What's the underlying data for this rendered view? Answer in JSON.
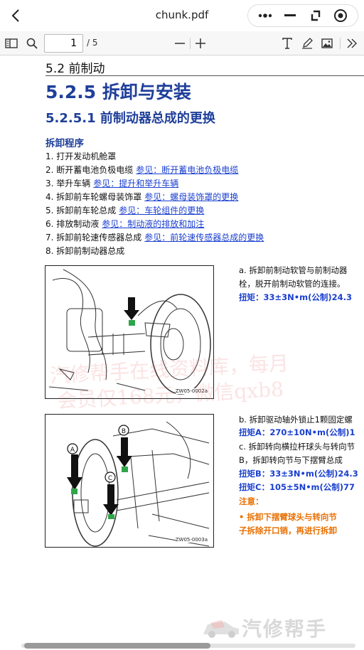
{
  "app": {
    "title": "chunk.pdf"
  },
  "toolbar": {
    "page_current": "1",
    "page_total": "/ 5"
  },
  "doc": {
    "section": "5.2 前制动",
    "heading1": "5.2.5 拆卸与安装",
    "heading2": "5.2.5.1 前制动器总成的更换",
    "heading3": "拆卸程序",
    "steps": [
      {
        "num": "1.",
        "text": "打开发动机舱罩",
        "link": ""
      },
      {
        "num": "2.",
        "text": "断开蓄电池负极电缆",
        "link": "参见：断开蓄电池负极电缆"
      },
      {
        "num": "3.",
        "text": "举升车辆",
        "link": "参见：提升和举升车辆"
      },
      {
        "num": "4.",
        "text": "拆卸前车轮螺母装饰罩",
        "link": "参见：螺母装饰罩的更换"
      },
      {
        "num": "5.",
        "text": "拆卸前车轮总成",
        "link": "参见：车轮组件的更换"
      },
      {
        "num": "6.",
        "text": "排放制动液",
        "link": "参见：制动液的排放和加注"
      },
      {
        "num": "7.",
        "text": "拆卸前轮速传感器总成",
        "link": "参见：前轮速传感器总成的更换"
      },
      {
        "num": "8.",
        "text": "拆卸前制动器总成",
        "link": ""
      }
    ],
    "figures": [
      {
        "code": "ZW05-0002a"
      },
      {
        "code": "ZW05-0003a",
        "labels": [
          "A",
          "B",
          "C"
        ]
      }
    ],
    "right_lines": [
      {
        "text": "a.  拆卸前制动软管与前制动器",
        "style": "plain"
      },
      {
        "text": "     栓，脱开前制动软管的连接。",
        "style": "plain"
      },
      {
        "text": "     扭矩：33±3N•m(公制)24.3",
        "style": "blue"
      },
      {
        "text": "b.  拆卸驱动轴外锁止1颗固定螺",
        "style": "plain"
      },
      {
        "text": "     扭矩A：270±10N•m(公制)1",
        "style": "blue"
      },
      {
        "text": "c.  拆卸转向横拉杆球头与转向节",
        "style": "plain"
      },
      {
        "text": "     B，拆卸转向节与下摆臂总成",
        "style": "plain"
      },
      {
        "text": "     扭矩B：33±3N•m(公制)24.3",
        "style": "blue"
      },
      {
        "text": "     扭矩C：105±5N•m(公制)77",
        "style": "blue"
      },
      {
        "text": "       注意：",
        "style": "orange"
      },
      {
        "text": "     •  拆卸下摆臂球头与转向节",
        "style": "orange"
      },
      {
        "text": "         子拆除开口销，再进行拆卸",
        "style": "orange"
      }
    ],
    "watermark_lines": [
      "汽修帮手在线资料库，每月",
      "会员仅168元，微信qxb8"
    ]
  },
  "footer": {
    "logo_text": "汽修帮手"
  },
  "icons": {
    "back": "chevron-left-icon",
    "more": "more-dots-icon",
    "minimize": "minus-icon",
    "expand": "expand-icon",
    "close": "target-close-icon",
    "sidebar": "sidebar-toggle-icon",
    "search": "search-icon",
    "zoom_out": "zoom-out-icon",
    "zoom_in": "zoom-in-icon",
    "text": "text-tool-icon",
    "draw": "pen-icon",
    "image": "image-icon",
    "more_tools": "double-chevron-icon"
  },
  "colors": {
    "heading_blue": "#1f3f9a",
    "link_blue": "#1a3fcf",
    "warning_orange": "#e86f00"
  }
}
